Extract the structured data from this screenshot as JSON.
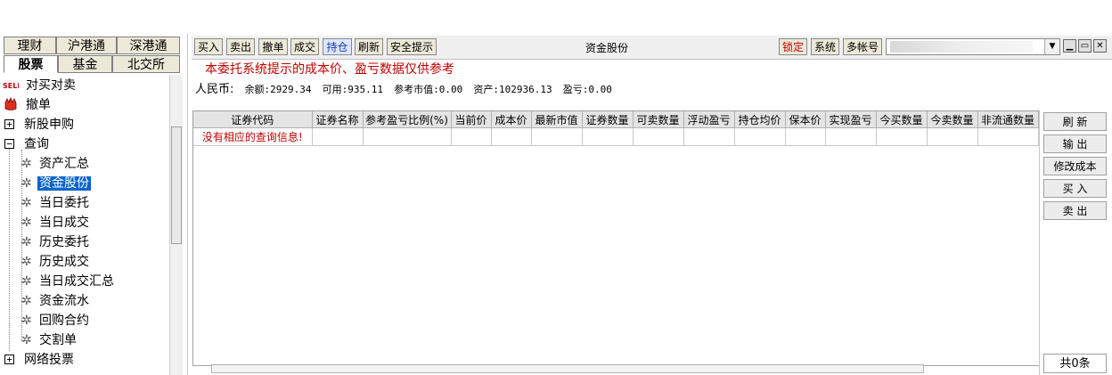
{
  "left_tabs_row1": [
    "理财",
    "沪港通",
    "深港通"
  ],
  "left_tabs_row2": [
    "股票",
    "基金",
    "北交所"
  ],
  "tree": {
    "buy_sell": "对买对卖",
    "cancel": "撤单",
    "ipo": "新股申购",
    "query": "查询",
    "query_items": [
      "资产汇总",
      "资金股份",
      "当日委托",
      "当日成交",
      "历史委托",
      "历史成交",
      "当日成交汇总",
      "资金流水",
      "回购合约",
      "交割单"
    ],
    "vote": "网络投票"
  },
  "toolbar": {
    "buttons": [
      "买入",
      "卖出",
      "撤单",
      "成交",
      "持仓",
      "刷新",
      "安全提示"
    ],
    "title": "资金股份",
    "lock": "锁定",
    "system": "系统",
    "multi_account": "多帐号"
  },
  "notice": "本委托系统提示的成本价、盈亏数据仅供参考",
  "account": {
    "currency": "人民币:",
    "balance": "余额:2929.34",
    "available": "可用:935.11",
    "market_value": "参考市值:0.00",
    "assets": "资产:102936.13",
    "profit": "盈亏:0.00"
  },
  "table": {
    "headers": [
      "证券代码",
      "证券名称",
      "参考盈亏比例(%)",
      "当前价",
      "成本价",
      "最新市值",
      "证券数量",
      "可卖数量",
      "浮动盈亏",
      "持仓均价",
      "保本价",
      "实现盈亏",
      "今买数量",
      "今卖数量",
      "非流通数量"
    ],
    "empty_message": "没有相应的查询信息!"
  },
  "right_buttons": [
    "刷 新",
    "输 出",
    "修改成本",
    "买 入",
    "卖 出"
  ],
  "record_count": "共0条"
}
